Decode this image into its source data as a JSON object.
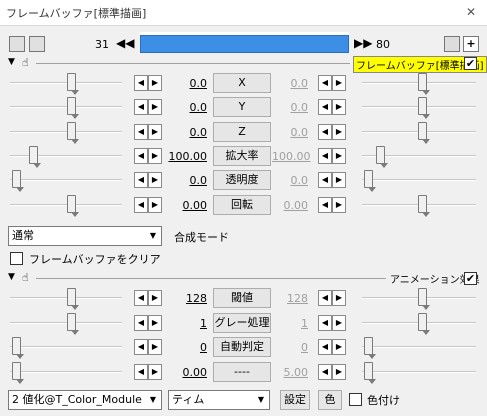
{
  "window": {
    "title": "フレームバッファ[標準描画]",
    "close": "✕"
  },
  "timeline": {
    "start_frame": "31",
    "end_frame": "80",
    "prev": "◀◀",
    "next": "▶▶"
  },
  "section1": {
    "name": "フレームバッファ[標準描画]",
    "checked": "✔",
    "params": [
      {
        "label": "X",
        "left": "0.0",
        "right": "0.0"
      },
      {
        "label": "Y",
        "left": "0.0",
        "right": "0.0"
      },
      {
        "label": "Z",
        "left": "0.0",
        "right": "0.0"
      },
      {
        "label": "拡大率",
        "left": "100.00",
        "right": "100.00"
      },
      {
        "label": "透明度",
        "left": "0.0",
        "right": "0.0"
      },
      {
        "label": "回転",
        "left": "0.00",
        "right": "0.00"
      }
    ],
    "blend_mode": "通常",
    "blend_label": "合成モード",
    "clear_label": "フレームバッファをクリア"
  },
  "section2": {
    "name": "アニメーション効果",
    "checked": "✔",
    "params": [
      {
        "label": "閾値",
        "left": "128",
        "right": "128"
      },
      {
        "label": "グレー処理",
        "left": "1",
        "right": "1"
      },
      {
        "label": "自動判定",
        "left": "0",
        "right": "0"
      },
      {
        "label": "----",
        "left": "0.00",
        "right": "5.00"
      }
    ],
    "effect_select": "2 値化@T_Color_Module",
    "time_select": "ティム",
    "settings_btn": "設定",
    "color_btn": "色",
    "color_attach": "色付け"
  },
  "arrows": {
    "left": "◀",
    "right": "▶",
    "tri": "▼"
  }
}
